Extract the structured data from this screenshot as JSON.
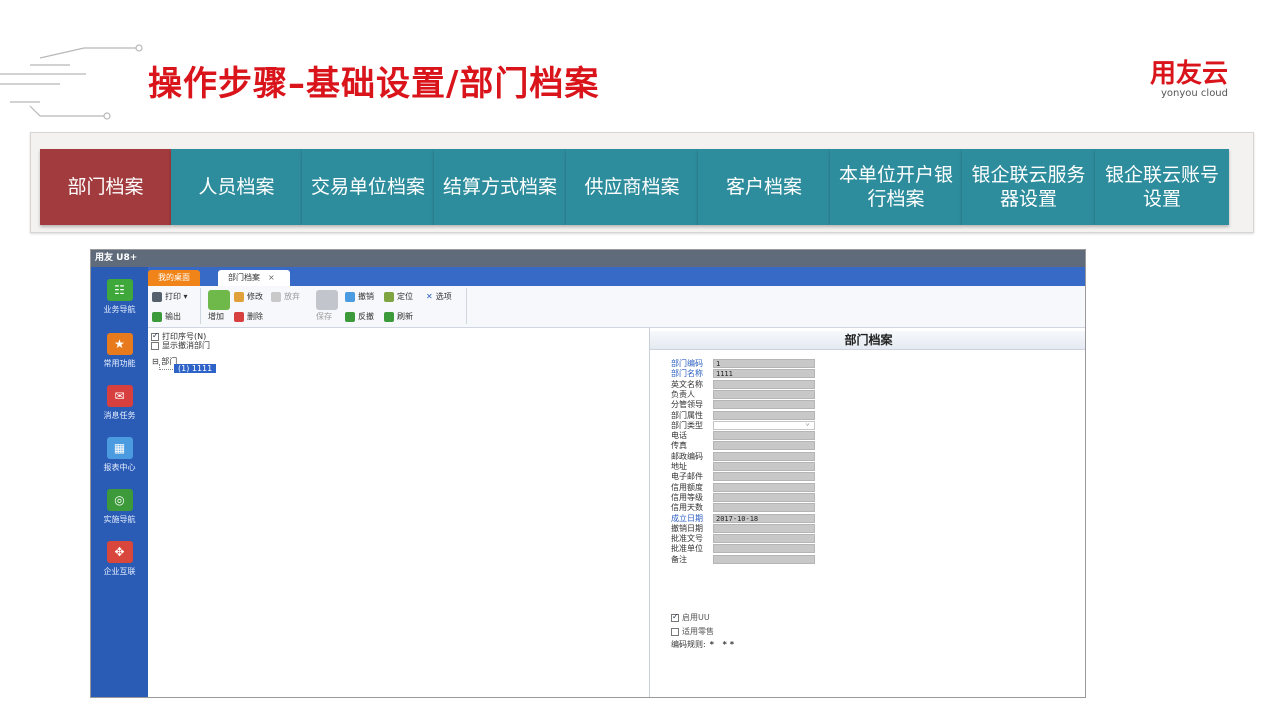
{
  "slide": {
    "title": "操作步骤–基础设置/部门档案",
    "brand_name": "用友云",
    "brand_sub": "yonyou cloud"
  },
  "tabs": [
    {
      "label": "部门档案",
      "active": true
    },
    {
      "label": "人员档案",
      "active": false
    },
    {
      "label": "交易单位档案",
      "active": false
    },
    {
      "label": "结算方式档案",
      "active": false
    },
    {
      "label": "供应商档案",
      "active": false
    },
    {
      "label": "客户档案",
      "active": false
    },
    {
      "label": "本单位开户银行档案",
      "active": false
    },
    {
      "label": "银企联云服务器设置",
      "active": false
    },
    {
      "label": "银企联云账号设置",
      "active": false
    }
  ],
  "app": {
    "title": "用友 U8+",
    "nav": [
      "业务导航",
      "常用功能",
      "消息任务",
      "报表中心",
      "实施导航",
      "企业互联"
    ],
    "window_tabs": [
      "我的桌面",
      "部门档案"
    ],
    "toolbar": {
      "print": "打印",
      "export": "输出",
      "add": "增加",
      "edit": "修改",
      "abandon": "放弃",
      "delete": "删除",
      "save": "保存",
      "cancel": "撤销",
      "unaudit": "反撤",
      "locate": "定位",
      "refresh": "刷新",
      "options": "选项"
    },
    "checks": {
      "print_seq": "打印序号(N)",
      "show_cancelled": "显示撤消部门"
    },
    "tree": {
      "root": "部门",
      "node": "(1) 1111"
    },
    "form": {
      "header": "部门档案",
      "fields": [
        {
          "label": "部门编码",
          "value": "1",
          "required": true
        },
        {
          "label": "部门名称",
          "value": "1111",
          "required": true
        },
        {
          "label": "英文名称",
          "value": "",
          "required": false
        },
        {
          "label": "负责人",
          "value": "",
          "required": false
        },
        {
          "label": "分管领导",
          "value": "",
          "required": false
        },
        {
          "label": "部门属性",
          "value": "",
          "required": false
        },
        {
          "label": "部门类型",
          "value": "",
          "required": false,
          "select": true
        },
        {
          "label": "电话",
          "value": "",
          "required": false
        },
        {
          "label": "传真",
          "value": "",
          "required": false
        },
        {
          "label": "邮政编码",
          "value": "",
          "required": false
        },
        {
          "label": "地址",
          "value": "",
          "required": false
        },
        {
          "label": "电子邮件",
          "value": "",
          "required": false
        },
        {
          "label": "信用额度",
          "value": "",
          "required": false
        },
        {
          "label": "信用等级",
          "value": "",
          "required": false
        },
        {
          "label": "信用天数",
          "value": "",
          "required": false
        },
        {
          "label": "成立日期",
          "value": "2017-10-18",
          "required": true
        },
        {
          "label": "撤销日期",
          "value": "",
          "required": false
        },
        {
          "label": "批准文号",
          "value": "",
          "required": false
        },
        {
          "label": "批准单位",
          "value": "",
          "required": false
        },
        {
          "label": "备注",
          "value": "",
          "required": false
        }
      ],
      "enable_uu": "启用UU",
      "retail": "适用零售",
      "code_rule_label": "编码规则:",
      "code_rule_value": "* **"
    }
  },
  "colors": {
    "title_red": "#d9141b",
    "tab_teal": "#2e8d9d",
    "tab_active": "#a23b3d",
    "app_blue": "#2a5cb6"
  }
}
